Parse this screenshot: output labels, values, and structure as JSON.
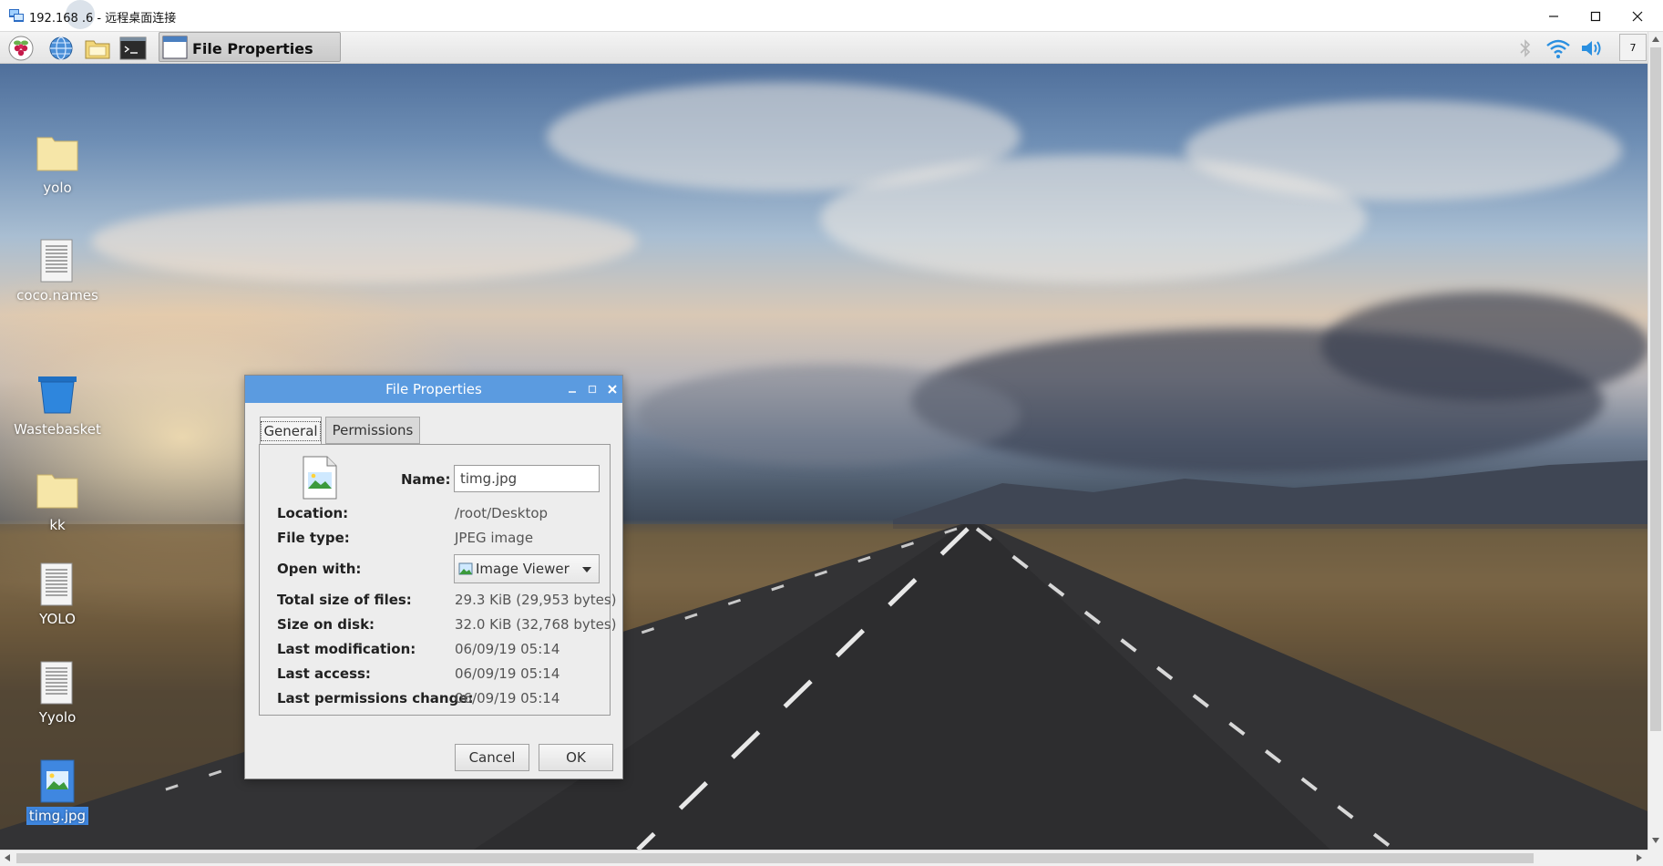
{
  "rdp_window": {
    "title": "192.168  .6 - 远程桌面连接",
    "icons": {
      "app": "remote-desktop-icon",
      "minimize": "minimize-icon",
      "maximize": "maximize-icon",
      "close": "close-icon"
    }
  },
  "panel": {
    "launchers": [
      {
        "name": "raspberry-menu-icon"
      },
      {
        "name": "web-browser-icon"
      },
      {
        "name": "file-manager-icon"
      },
      {
        "name": "terminal-icon"
      }
    ],
    "taskbar_button": {
      "label": "File Properties"
    },
    "tray": {
      "bluetooth": "bluetooth-icon",
      "wifi": "wifi-icon",
      "volume": "volume-icon",
      "clock_text": "7"
    }
  },
  "desktop": {
    "icons": [
      {
        "label": "yolo",
        "type": "folder"
      },
      {
        "label": "coco.names",
        "type": "text"
      },
      {
        "label": "Wastebasket",
        "type": "trash"
      },
      {
        "label": "kk",
        "type": "folder"
      },
      {
        "label": "YOLO",
        "type": "text"
      },
      {
        "label": "Yyolo",
        "type": "text"
      },
      {
        "label": "timg.jpg",
        "type": "image",
        "selected": true
      }
    ]
  },
  "dialog": {
    "title": "File Properties",
    "tabs": [
      "General",
      "Permissions"
    ],
    "active_tab": "General",
    "fields": {
      "name_label": "Name:",
      "name_value": "timg.jpg",
      "location_label": "Location:",
      "location_value": "/root/Desktop",
      "file_type_label": "File type:",
      "file_type_value": "JPEG image",
      "open_with_label": "Open with:",
      "open_with_value": "Image Viewer",
      "total_size_label": "Total size of files:",
      "total_size_value": "29.3 KiB (29,953 bytes)",
      "size_on_disk_label": "Size on disk:",
      "size_on_disk_value": "32.0 KiB (32,768 bytes)",
      "last_mod_label": "Last modification:",
      "last_mod_value": "06/09/19 05:14",
      "last_access_label": "Last access:",
      "last_access_value": "06/09/19 05:14",
      "last_perm_label": "Last permissions change:",
      "last_perm_value": "06/09/19 05:14"
    },
    "buttons": {
      "cancel": "Cancel",
      "ok": "OK"
    }
  },
  "colors": {
    "dialog_titlebar": "#5b9be0",
    "selection": "#3f87e0"
  }
}
